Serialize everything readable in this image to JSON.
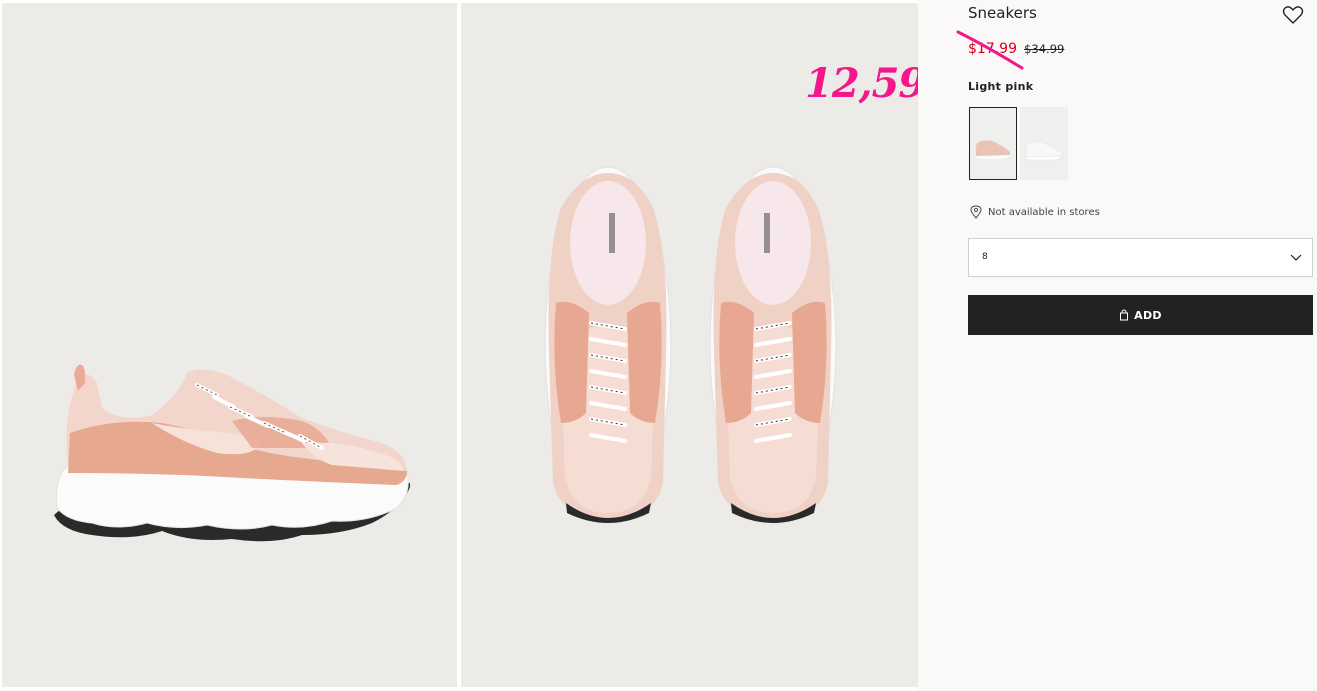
{
  "product": {
    "title": "Sneakers",
    "sale_price": "$17.99",
    "original_price": "$34.99",
    "color_name": "Light pink",
    "availability": "Not available in stores",
    "size_selected": "8",
    "add_label": "ADD",
    "swatches": [
      {
        "color": "#e8c9bf",
        "selected": true
      },
      {
        "color": "#ffffff",
        "selected": false
      }
    ]
  },
  "annotation": {
    "handwritten_price": "12,59",
    "color": "#f4168b"
  },
  "colors": {
    "sale": "#d6001c",
    "button": "#222222",
    "shoe_pink": "#f0cfc4",
    "shoe_peach": "#e8a58f",
    "photo_bg": "#ecebe8"
  },
  "icons": {
    "favorite": "heart-outline-icon",
    "location": "map-pin-icon",
    "dropdown": "chevron-down-icon",
    "add": "shopping-bag-icon"
  }
}
